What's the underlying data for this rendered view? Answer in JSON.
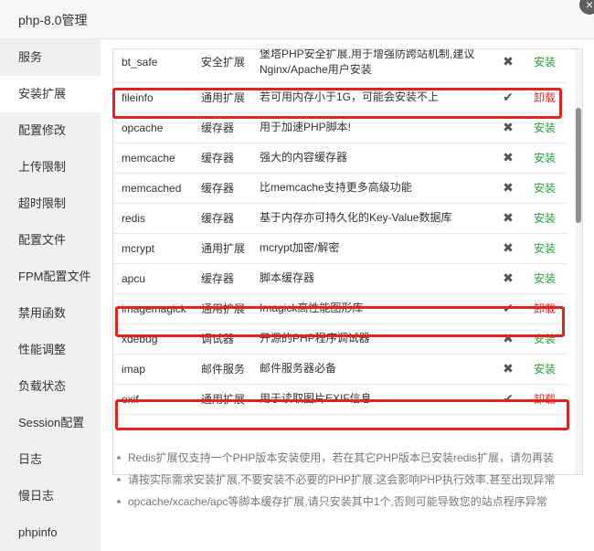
{
  "window": {
    "title": "php-8.0管理",
    "close_icon": "×"
  },
  "sidebar": {
    "items": [
      {
        "label": "服务",
        "active": false
      },
      {
        "label": "安装扩展",
        "active": true
      },
      {
        "label": "配置修改",
        "active": false
      },
      {
        "label": "上传限制",
        "active": false
      },
      {
        "label": "超时限制",
        "active": false
      },
      {
        "label": "配置文件",
        "active": false
      },
      {
        "label": "FPM配置文件",
        "active": false
      },
      {
        "label": "禁用函数",
        "active": false
      },
      {
        "label": "性能调整",
        "active": false
      },
      {
        "label": "负载状态",
        "active": false
      },
      {
        "label": "Session配置",
        "active": false
      },
      {
        "label": "日志",
        "active": false
      },
      {
        "label": "慢日志",
        "active": false
      },
      {
        "label": "phpinfo",
        "active": false
      }
    ]
  },
  "extensions": {
    "rows": [
      {
        "name": "bt_safe",
        "type": "安全扩展",
        "desc": "堡塔PHP安全扩展,用于增强防跨站机制,建议Nginx/Apache用户安装",
        "installed": false,
        "status": "✖",
        "action": "安装"
      },
      {
        "name": "fileinfo",
        "type": "通用扩展",
        "desc": "若可用内存小于1G，可能会安装不上",
        "installed": true,
        "status": "✔",
        "action": "卸载"
      },
      {
        "name": "opcache",
        "type": "缓存器",
        "desc": "用于加速PHP脚本!",
        "installed": false,
        "status": "✖",
        "action": "安装"
      },
      {
        "name": "memcache",
        "type": "缓存器",
        "desc": "强大的内容缓存器",
        "installed": false,
        "status": "✖",
        "action": "安装"
      },
      {
        "name": "memcached",
        "type": "缓存器",
        "desc": "比memcache支持更多高级功能",
        "installed": false,
        "status": "✖",
        "action": "安装"
      },
      {
        "name": "redis",
        "type": "缓存器",
        "desc": "基于内存亦可持久化的Key-Value数据库",
        "installed": false,
        "status": "✖",
        "action": "安装"
      },
      {
        "name": "mcrypt",
        "type": "通用扩展",
        "desc": "mcrypt加密/解密",
        "installed": false,
        "status": "✖",
        "action": "安装"
      },
      {
        "name": "apcu",
        "type": "缓存器",
        "desc": "脚本缓存器",
        "installed": false,
        "status": "✖",
        "action": "安装"
      },
      {
        "name": "imagemagick",
        "type": "通用扩展",
        "desc": "Imagick高性能图形库",
        "installed": true,
        "status": "✔",
        "action": "卸载"
      },
      {
        "name": "xdebug",
        "type": "调试器",
        "desc": "开源的PHP程序调试器",
        "installed": false,
        "status": "✖",
        "action": "安装"
      },
      {
        "name": "imap",
        "type": "邮件服务",
        "desc": "邮件服务器必备",
        "installed": false,
        "status": "✖",
        "action": "安装"
      },
      {
        "name": "exif",
        "type": "通用扩展",
        "desc": "用于读取图片EXIF信息",
        "installed": true,
        "status": "✔",
        "action": "卸载"
      }
    ]
  },
  "notes": [
    "Redis扩展仅支持一个PHP版本安装使用，若在其它PHP版本已安装redis扩展，请勿再装",
    "请按实际需求安装扩展,不要安装不必要的PHP扩展,这会影响PHP执行效率,甚至出现异常",
    "opcache/xcache/apc等脚本缓存扩展,请只安装其中1个,否则可能导致您的站点程序异常"
  ],
  "colors": {
    "install": "#20a53a",
    "uninstall": "#e22b2b",
    "highlight": "#e3231c"
  }
}
